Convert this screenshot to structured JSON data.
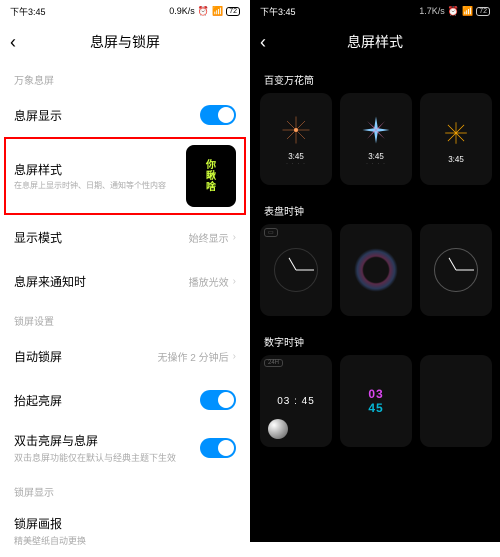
{
  "left": {
    "status": {
      "time": "下午3:45",
      "net": "0.9K/s",
      "battery": "72"
    },
    "title": "息屏与锁屏",
    "section1": "万象息屏",
    "aod_display": "息屏显示",
    "aod_style": {
      "label": "息屏样式",
      "sub": "在息屏上显示时钟、日期、通知等个性内容",
      "preview": "你\n瞅\n啥"
    },
    "display_mode": {
      "label": "显示模式",
      "value": "始终显示"
    },
    "aod_notify": {
      "label": "息屏来通知时",
      "value": "播放光效"
    },
    "section2": "锁屏设置",
    "auto_lock": {
      "label": "自动锁屏",
      "value": "无操作 2 分钟后"
    },
    "raise_wake": "抬起亮屏",
    "double_tap": {
      "label": "双击亮屏与息屏",
      "sub": "双击息屏功能仅在默认与经典主题下生效"
    },
    "section3": "锁屏显示",
    "wallpaper": {
      "label": "锁屏画报",
      "sub": "精美壁纸自动更换"
    }
  },
  "right": {
    "status": {
      "time": "下午3:45",
      "net": "1.7K/s",
      "battery": "72"
    },
    "title": "息屏样式",
    "section1": "百变万花筒",
    "section2": "表盘时钟",
    "section3": "数字时钟",
    "card_time": "3:45",
    "card_dots": "· · · ·",
    "digital1": "03 : 45",
    "digital2a": "03",
    "digital2b": "45",
    "badge_text": "24H"
  }
}
